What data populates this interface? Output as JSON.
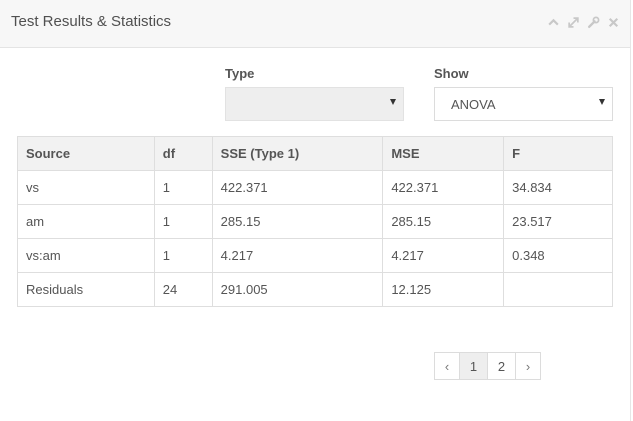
{
  "panel": {
    "title": "Test Results & Statistics",
    "tools": [
      {
        "icon": "chevron-up-icon"
      },
      {
        "icon": "expand-icon"
      },
      {
        "icon": "wrench-icon"
      },
      {
        "icon": "close-icon"
      }
    ]
  },
  "filters": {
    "type": {
      "label": "Type",
      "value": ""
    },
    "show": {
      "label": "Show",
      "value": "ANOVA"
    }
  },
  "table": {
    "headers": [
      "Source",
      "df",
      "SSE (Type 1)",
      "MSE",
      "F"
    ],
    "rows": [
      [
        "vs",
        "1",
        "422.371",
        "422.371",
        "34.834"
      ],
      [
        "am",
        "1",
        "285.15",
        "285.15",
        "23.517"
      ],
      [
        "vs:am",
        "1",
        "4.217",
        "4.217",
        "0.348"
      ],
      [
        "Residuals",
        "24",
        "291.005",
        "12.125",
        ""
      ]
    ]
  },
  "pagination": {
    "prev": "‹",
    "pages": [
      "1",
      "2"
    ],
    "active_page": "1",
    "next": "›"
  }
}
